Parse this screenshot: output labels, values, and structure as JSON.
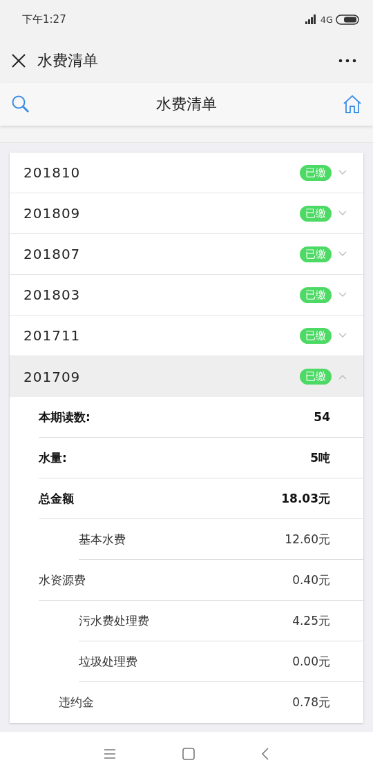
{
  "status_bar": {
    "time": "下午1:27",
    "network": "4G"
  },
  "header": {
    "title": "水费清单"
  },
  "toolbar": {
    "title": "水费清单"
  },
  "bills": [
    {
      "period": "201810",
      "status": "已缴",
      "expanded": false
    },
    {
      "period": "201809",
      "status": "已缴",
      "expanded": false
    },
    {
      "period": "201807",
      "status": "已缴",
      "expanded": false
    },
    {
      "period": "201803",
      "status": "已缴",
      "expanded": false
    },
    {
      "period": "201711",
      "status": "已缴",
      "expanded": false
    },
    {
      "period": "201709",
      "status": "已缴",
      "expanded": true,
      "details": [
        {
          "kind": "total",
          "label": "本期读数:",
          "value": "54"
        },
        {
          "kind": "total",
          "label": "水量:",
          "value": "5吨"
        },
        {
          "kind": "total",
          "label": "总金额",
          "value": "18.03元"
        },
        {
          "kind": "sub",
          "label": "基本水费",
          "value": "12.60元"
        },
        {
          "kind": "item",
          "label": "水资源费",
          "value": "0.40元"
        },
        {
          "kind": "sub",
          "label": "污水费处理费",
          "value": "4.25元"
        },
        {
          "kind": "sub",
          "label": "垃圾处理费",
          "value": "0.00元"
        },
        {
          "kind": "penalty",
          "label": "违约金",
          "value": "0.78元"
        }
      ]
    }
  ]
}
